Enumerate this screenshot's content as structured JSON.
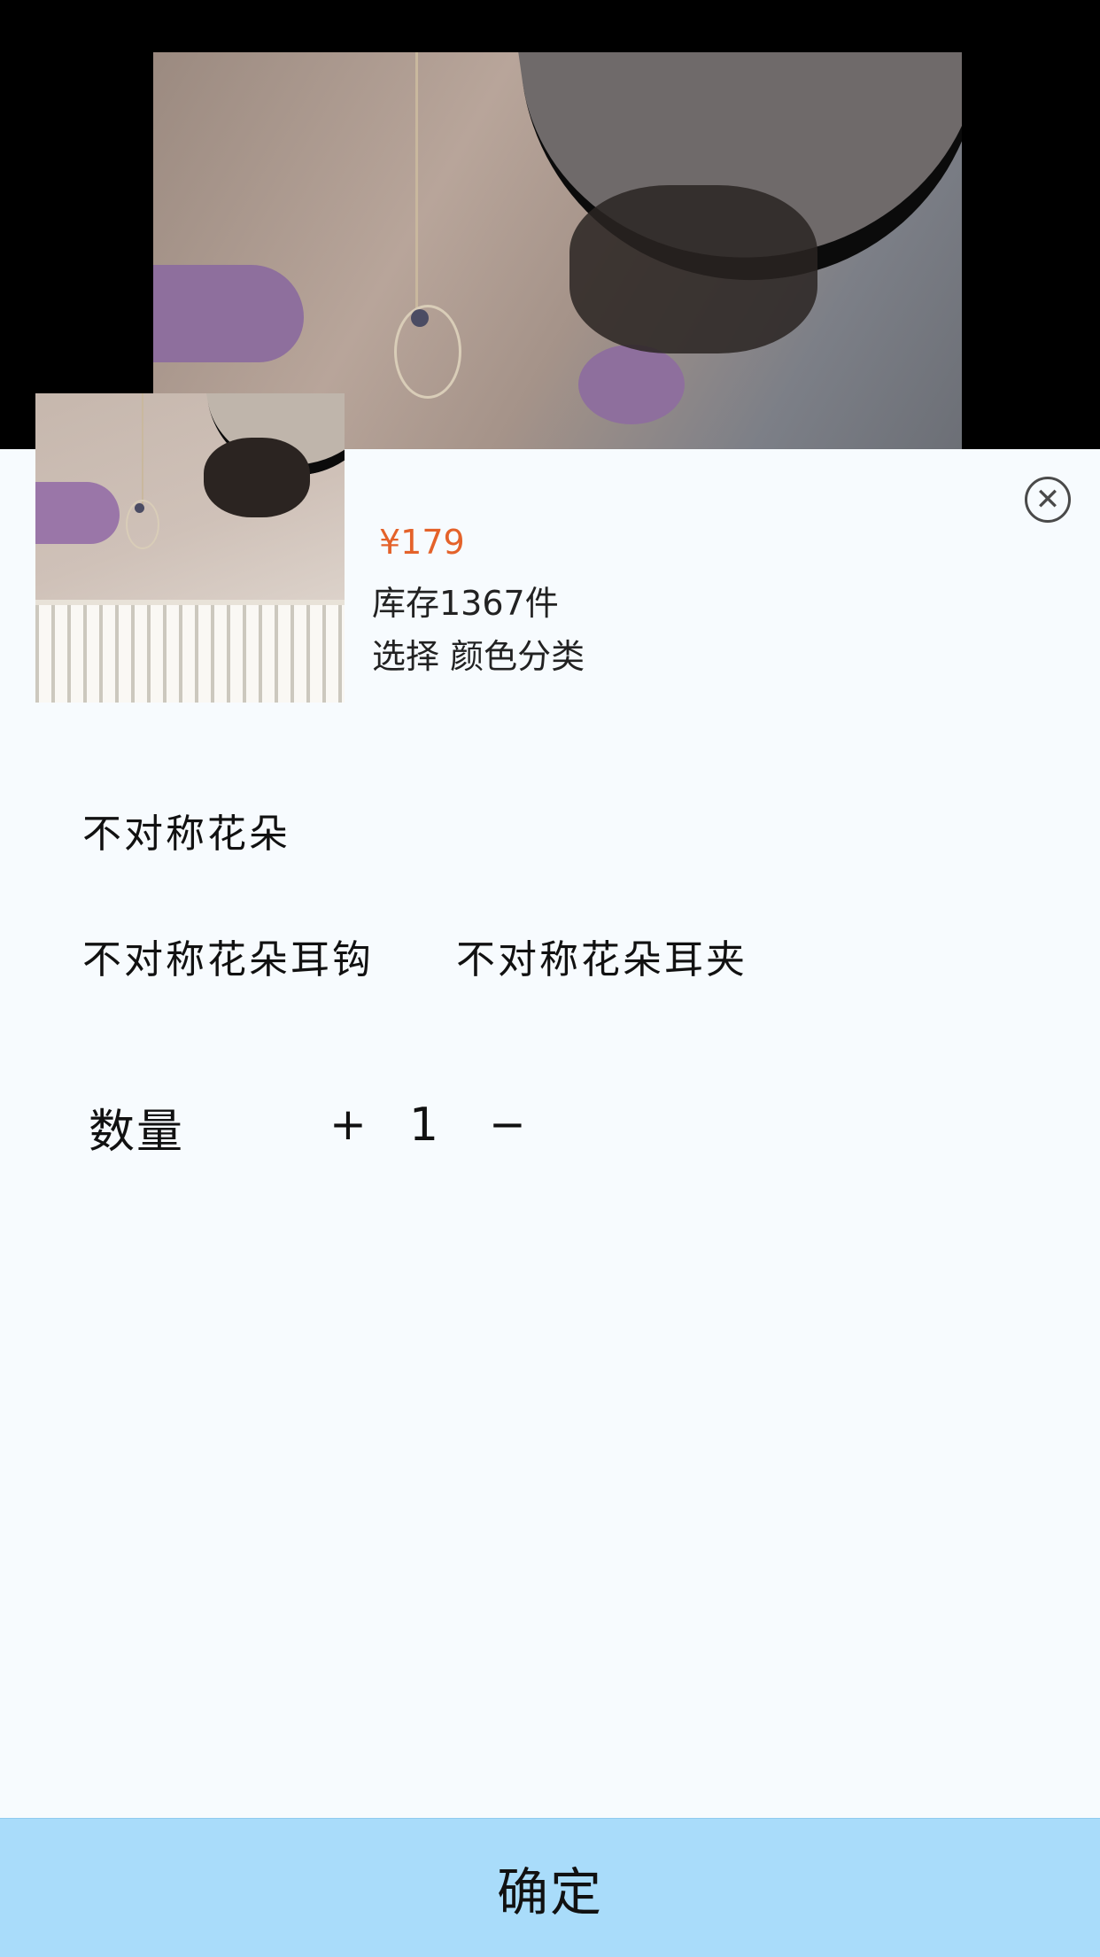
{
  "product": {
    "price": "¥179",
    "stock": "库存1367件",
    "select_hint": "选择  颜色分类"
  },
  "close": {
    "icon": "close-icon",
    "symbol": "✕"
  },
  "variants": {
    "group_title": "不对称花朵",
    "options": [
      {
        "label": "不对称花朵耳钩"
      },
      {
        "label": "不对称花朵耳夹"
      }
    ]
  },
  "quantity": {
    "label": "数量",
    "plus": "+",
    "value": "1",
    "minus": "−"
  },
  "confirm_button": {
    "label": "确定"
  },
  "colors": {
    "price": "#e4622a",
    "confirm_bg": "#a9dcfa",
    "sheet_bg": "#f7fbfe"
  }
}
